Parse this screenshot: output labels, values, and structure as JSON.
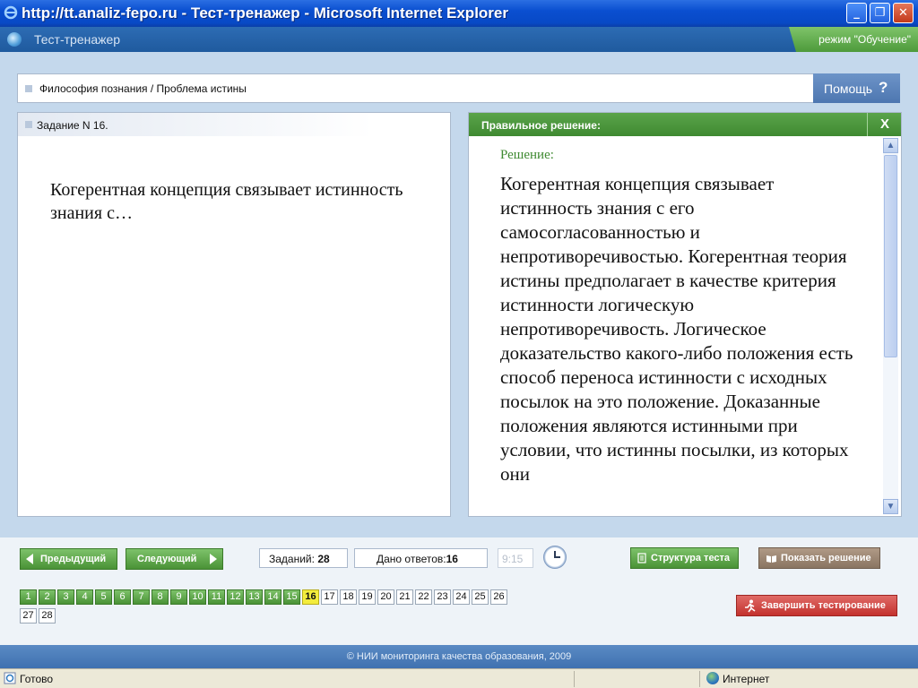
{
  "window": {
    "title": "http://tt.analiz-fepo.ru - Тест-тренажер - Microsoft Internet Explorer",
    "buttons": {
      "minimize": "_",
      "maximize": "❐",
      "close": "✕"
    }
  },
  "app": {
    "title": "Тест-тренажер",
    "mode": "режим \"Обучение\""
  },
  "breadcrumb": "Философия познания / Проблема истины",
  "help": {
    "label": "Помощь",
    "icon": "?"
  },
  "task": {
    "header": "Задание N 16.",
    "question": "Когерентная концепция связывает истинность знания с…"
  },
  "solution": {
    "panel_title": "Правильное решение:",
    "close_label": "X",
    "heading": "Решение:",
    "text": "Когерентная концепция связывает истинность знания с его самосогласованностью и непротиворечивостью. Когерентная теория истины предполагает в качестве критерия истинности логическую непротиворечивость. Логическое доказательство какого-либо положения есть способ переноса истинности с исходных посылок на это положение. Доказанные положения являются  истинными при условии, что истинны посылки, из которых они"
  },
  "nav": {
    "prev": "Предыдущий",
    "next": "Следующий",
    "tasks_label": "Заданий:",
    "tasks_count": "28",
    "answers_label": "Дано ответов:",
    "answers_count": "16",
    "timer": "9:15",
    "structure": "Структура теста",
    "show_solution": "Показать решение",
    "finish": "Завершить тестирование"
  },
  "question_numbers": {
    "current": 16,
    "items": [
      "1",
      "2",
      "3",
      "4",
      "5",
      "6",
      "7",
      "8",
      "9",
      "10",
      "11",
      "12",
      "13",
      "14",
      "15",
      "16",
      "17",
      "18",
      "19",
      "20",
      "21",
      "22",
      "23",
      "24",
      "25",
      "26",
      "27",
      "28"
    ]
  },
  "footer": "© НИИ мониторинга качества образования, 2009",
  "statusbar": {
    "status": "Готово",
    "zone": "Интернет"
  },
  "colors": {
    "green": "#4a9236",
    "titlebar": "#0a4fd0",
    "current_question": "#f3ec3c",
    "finish": "#c3322e"
  }
}
